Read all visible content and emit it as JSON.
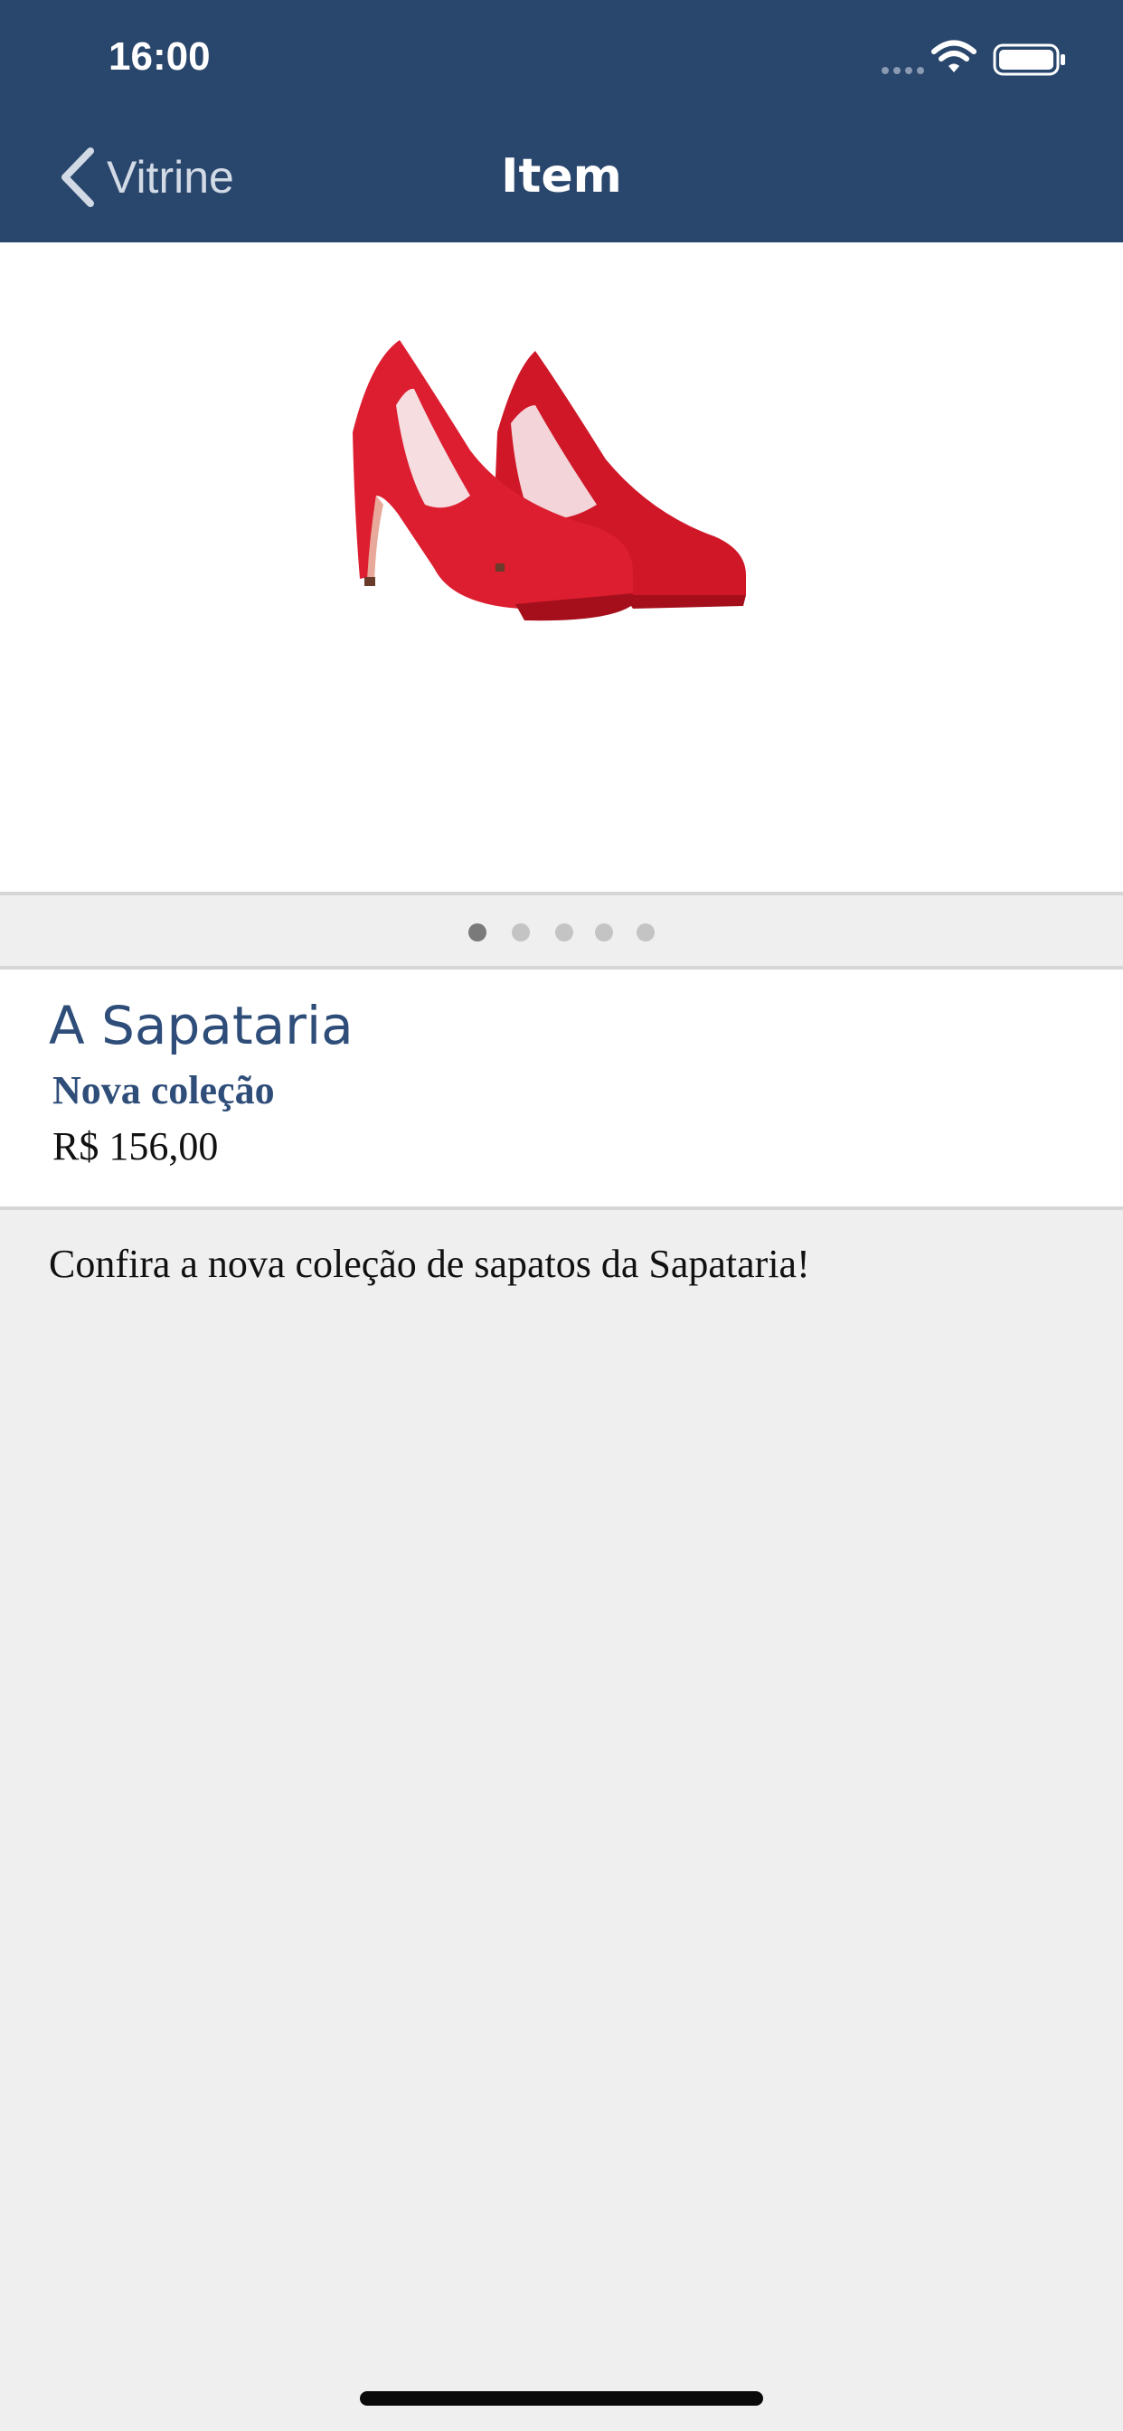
{
  "status_bar": {
    "time": "16:00"
  },
  "nav": {
    "back_label": "Vitrine",
    "title": "Item"
  },
  "gallery": {
    "image_icon": "red-high-heels-photo",
    "page_count": 5,
    "current_page": 1
  },
  "product": {
    "store_name": "A Sapataria",
    "subtitle": "Nova coleção",
    "price": "R$ 156,00",
    "description": "Confira a nova coleção de sapatos da Sapataria!"
  },
  "colors": {
    "header": "#29466c",
    "accent_text": "#2e4d79",
    "background": "#efefef"
  }
}
